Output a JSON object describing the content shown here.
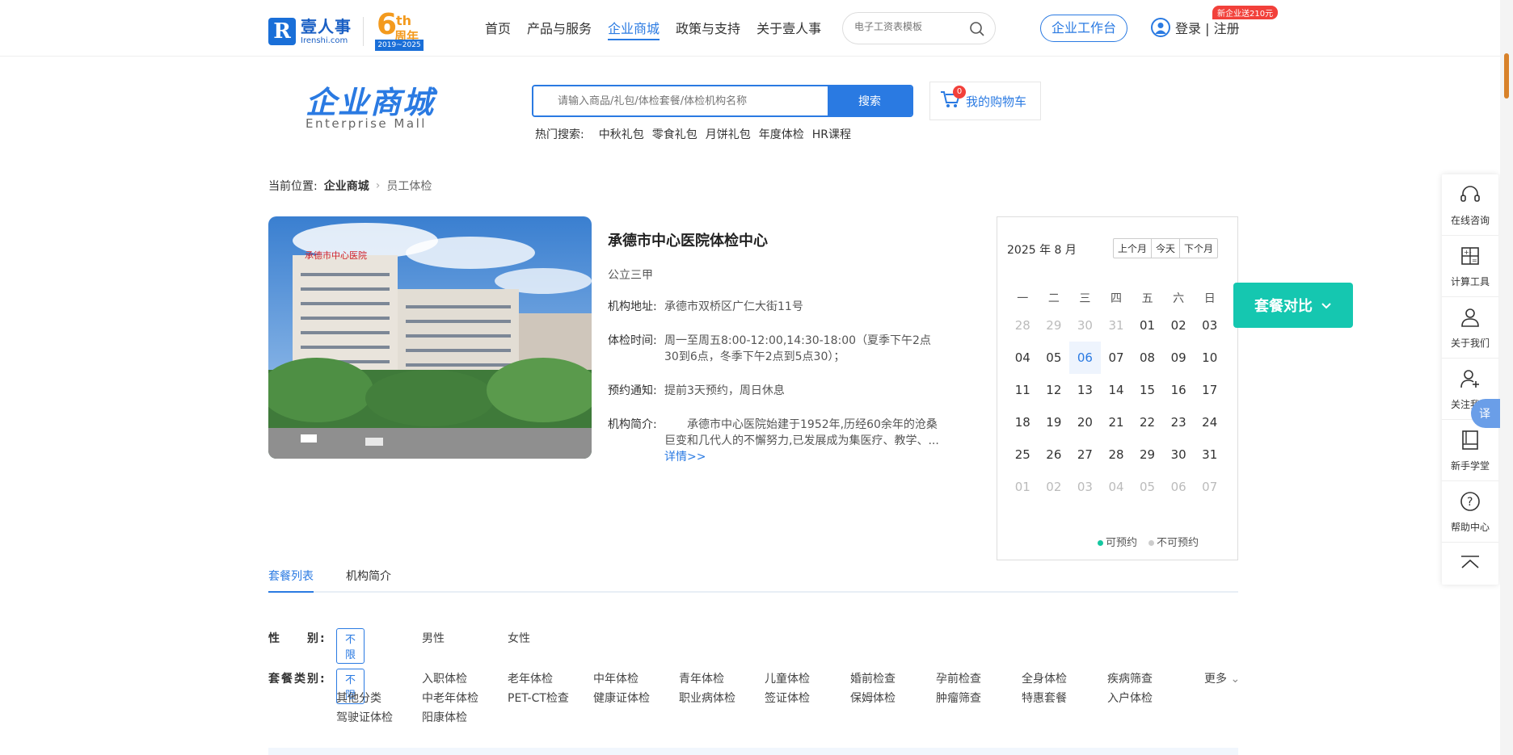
{
  "header": {
    "logo_cn": "壹人事",
    "logo_en": "Irenshi.com",
    "anniv_num": "6",
    "anniv_th": "th",
    "anniv_word": "周年",
    "anniv_years": "2019~2025",
    "nav": [
      "首页",
      "产品与服务",
      "企业商城",
      "政策与支持",
      "关于壹人事"
    ],
    "active_nav": "企业商城",
    "search_placeholder": "电子工资表模板",
    "workbench": "企业工作台",
    "login": "登录 | 注册",
    "promo": "新企业送210元"
  },
  "mall": {
    "title": "企业商城",
    "subtitle": "Enterprise Mall",
    "search_placeholder": "请输入商品/礼包/体检套餐/体检机构名称",
    "search_button": "搜索",
    "cart_label": "我的购物车",
    "cart_count": "0",
    "hot_label": "热门搜索:",
    "hot_items": [
      "中秋礼包",
      "零食礼包",
      "月饼礼包",
      "年度体检",
      "HR课程"
    ]
  },
  "breadcrumb": {
    "prefix": "当前位置:",
    "level1": "企业商城",
    "level2": "员工体检"
  },
  "hospital": {
    "name": "承德市中心医院体检中心",
    "level": "公立三甲",
    "address_label": "机构地址:",
    "address": "承德市双桥区广仁大街11号",
    "hours_label": "体检时间:",
    "hours": "周一至周五8:00-12:00,14:30-18:00（夏季下午2点30到6点，冬季下午2点到5点30）；",
    "notice_label": "预约通知:",
    "notice": "提前3天预约，周日休息",
    "intro_label": "机构简介:",
    "intro": "承德市中心医院始建于1952年,历经60余年的沧桑巨变和几代人的不懈努力,已发展成为集医疗、教学、...",
    "detail_link": "详情>>",
    "photo_sign": "承德市中心医院"
  },
  "calendar": {
    "title": "2025 年 8 月",
    "prev": "上个月",
    "today": "今天",
    "next": "下个月",
    "weekdays": [
      "一",
      "二",
      "三",
      "四",
      "五",
      "六",
      "日"
    ],
    "days": [
      {
        "d": "28",
        "s": "dim"
      },
      {
        "d": "29",
        "s": "dim"
      },
      {
        "d": "30",
        "s": "dim"
      },
      {
        "d": "31",
        "s": "dim"
      },
      {
        "d": "01",
        "s": ""
      },
      {
        "d": "02",
        "s": ""
      },
      {
        "d": "03",
        "s": ""
      },
      {
        "d": "04",
        "s": ""
      },
      {
        "d": "05",
        "s": ""
      },
      {
        "d": "06",
        "s": "today"
      },
      {
        "d": "07",
        "s": ""
      },
      {
        "d": "08",
        "s": ""
      },
      {
        "d": "09",
        "s": ""
      },
      {
        "d": "10",
        "s": ""
      },
      {
        "d": "11",
        "s": ""
      },
      {
        "d": "12",
        "s": ""
      },
      {
        "d": "13",
        "s": ""
      },
      {
        "d": "14",
        "s": ""
      },
      {
        "d": "15",
        "s": ""
      },
      {
        "d": "16",
        "s": ""
      },
      {
        "d": "17",
        "s": ""
      },
      {
        "d": "18",
        "s": ""
      },
      {
        "d": "19",
        "s": ""
      },
      {
        "d": "20",
        "s": ""
      },
      {
        "d": "21",
        "s": ""
      },
      {
        "d": "22",
        "s": ""
      },
      {
        "d": "23",
        "s": ""
      },
      {
        "d": "24",
        "s": ""
      },
      {
        "d": "25",
        "s": ""
      },
      {
        "d": "26",
        "s": ""
      },
      {
        "d": "27",
        "s": ""
      },
      {
        "d": "28",
        "s": ""
      },
      {
        "d": "29",
        "s": ""
      },
      {
        "d": "30",
        "s": ""
      },
      {
        "d": "31",
        "s": ""
      },
      {
        "d": "01",
        "s": "dim"
      },
      {
        "d": "02",
        "s": "dim"
      },
      {
        "d": "03",
        "s": "dim"
      },
      {
        "d": "04",
        "s": "dim"
      },
      {
        "d": "05",
        "s": "dim"
      },
      {
        "d": "06",
        "s": "dim"
      },
      {
        "d": "07",
        "s": "dim"
      }
    ],
    "legend_available": "可预约",
    "legend_unavailable": "不可预约",
    "available_color": "#15c7a0",
    "unavailable_color": "#cccccc"
  },
  "compare_button": "套餐对比",
  "side_tools": [
    "在线咨询",
    "计算工具",
    "关于我们",
    "关注我们",
    "新手学堂",
    "帮助中心"
  ],
  "translate": "译",
  "tabs": [
    "套餐列表",
    "机构简介"
  ],
  "filters": {
    "gender_label": "性　　别:",
    "gender_options": [
      "不限",
      "男性",
      "女性"
    ],
    "category_label": "套餐类别:",
    "category_row1": [
      "入职体检",
      "老年体检",
      "中年体检",
      "青年体检",
      "儿童体检",
      "婚前检查",
      "孕前检查",
      "全身体检",
      "疾病筛查"
    ],
    "category_row2": [
      "其他分类",
      "中老年体检",
      "PET-CT检查",
      "健康证体检",
      "职业病体检",
      "签证体检",
      "保姆体检",
      "肿瘤筛查",
      "特惠套餐",
      "入户体检"
    ],
    "category_row3": [
      "驾驶证体检",
      "阳康体检"
    ],
    "unlimited": "不限",
    "more": "更多"
  },
  "colors": {
    "accent": "#2a7ae2",
    "teal": "#15c7b0",
    "orange": "#f39a1e",
    "red": "#f2403a"
  }
}
